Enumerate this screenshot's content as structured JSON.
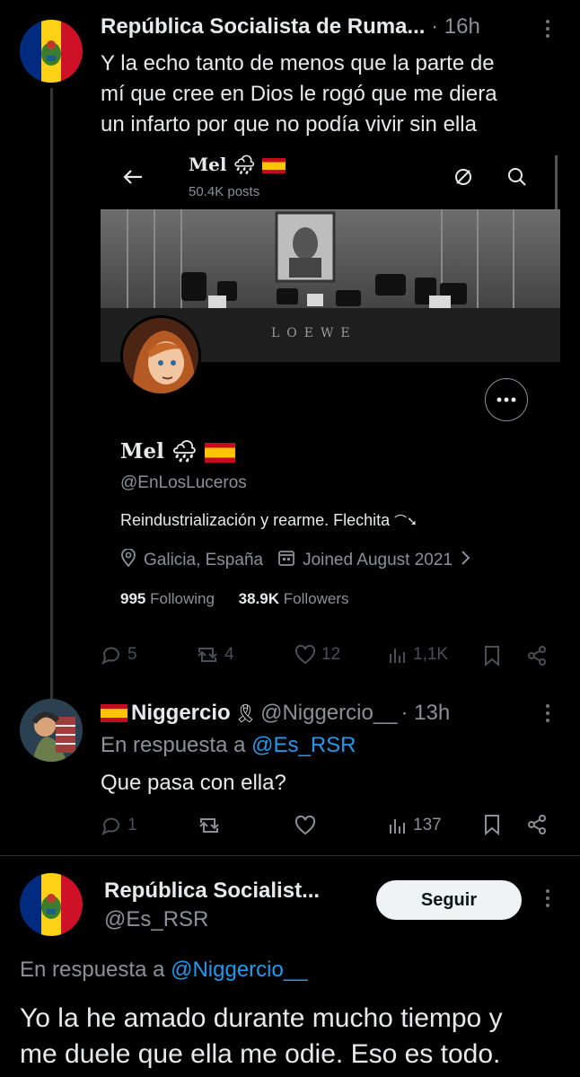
{
  "tweet1": {
    "display_name": "República Socialista de Ruma...",
    "time": "· 16h",
    "text_lines": [
      "Y la echo tanto de menos que la parte de",
      "mí que cree en Dios le rogó que me diera",
      "un infarto por que no podía vivir sin ella"
    ],
    "stats": {
      "replies": "5",
      "retweets": "4",
      "likes": "12",
      "views": "1,1K"
    }
  },
  "embedded_profile": {
    "header_name": "Mel",
    "posts": "50.4K posts",
    "name": "Mel",
    "handle": "@EnLosLuceros",
    "bio": "Reindustrialización y rearme. Flechita",
    "location": "Galicia, España",
    "joined": "Joined August 2021",
    "following_count": "995",
    "following_label": "Following",
    "followers_count": "38.9K",
    "followers_label": "Followers",
    "banner_sign": "LOEWE"
  },
  "reply1": {
    "display_name": "Niggercio",
    "handle": "@Niggercio__",
    "time": "· 13h",
    "replying_prefix": "En respuesta a",
    "replying_to": "@Es_RSR",
    "text": "Que pasa con ella?",
    "stats": {
      "replies": "1",
      "views": "137"
    }
  },
  "reply2": {
    "display_name": "República Socialist...",
    "handle": "@Es_RSR",
    "follow_label": "Seguir",
    "replying_prefix": "En respuesta a",
    "replying_to": "@Niggercio__",
    "text_lines": [
      "Yo la he amado durante mucho tiempo y",
      "me duele que ella me odie. Eso es todo."
    ]
  },
  "colors": {
    "link": "#1d9bf0",
    "romania_blue": "#002b7f",
    "romania_yellow": "#fcd116",
    "romania_red": "#ce1126"
  }
}
